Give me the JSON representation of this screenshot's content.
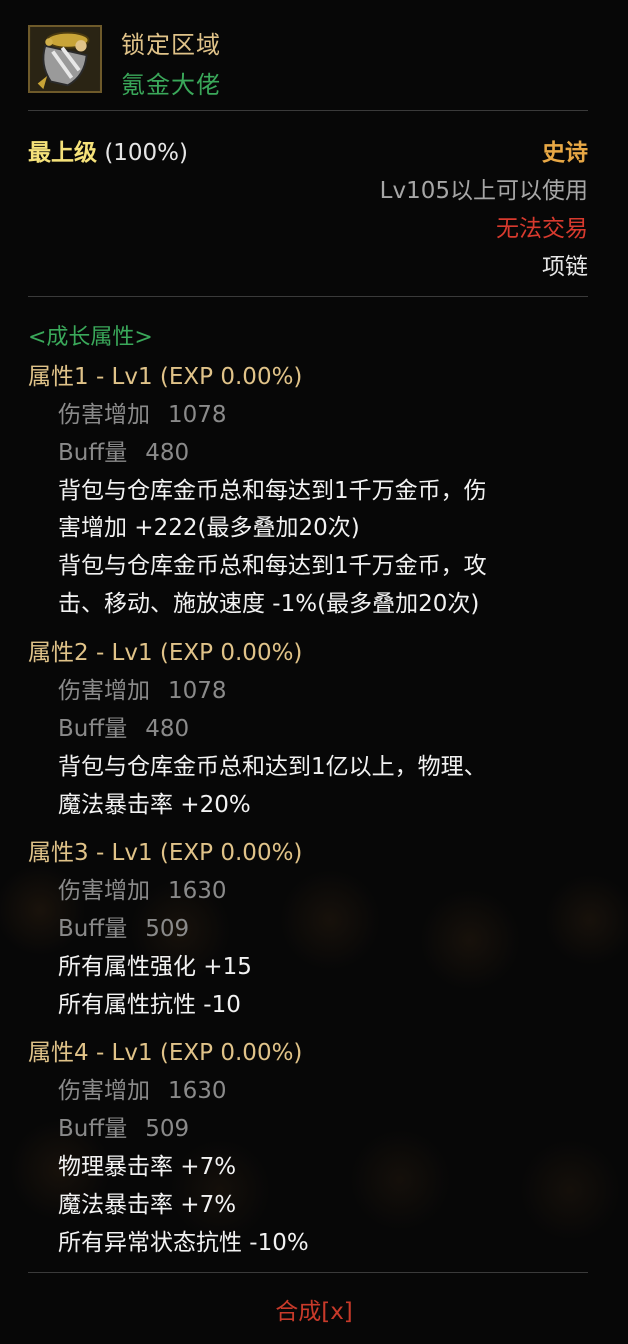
{
  "item": {
    "name": "锁定区域",
    "subtitle": "氪金大佬",
    "icon": "necklace-item-icon",
    "grade_label": "最上级",
    "grade_percent": "(100%)",
    "rarity": "史诗",
    "level_requirement": "Lv105以上可以使用",
    "trade_status": "无法交易",
    "slot": "项链"
  },
  "growth": {
    "header": "<成长属性>",
    "attributes": [
      {
        "title": "属性1 - Lv1 (EXP 0.00%)",
        "stats": [
          {
            "label": "伤害增加",
            "value": "1078"
          },
          {
            "label": "Buff量",
            "value": "480"
          }
        ],
        "effects": [
          "背包与仓库金币总和每达到1千万金币，伤",
          "害增加 +222(最多叠加20次)",
          "背包与仓库金币总和每达到1千万金币，攻",
          "击、移动、施放速度 -1%(最多叠加20次)"
        ]
      },
      {
        "title": "属性2 - Lv1 (EXP 0.00%)",
        "stats": [
          {
            "label": "伤害增加",
            "value": "1078"
          },
          {
            "label": "Buff量",
            "value": "480"
          }
        ],
        "effects": [
          "背包与仓库金币总和达到1亿以上，物理、",
          "魔法暴击率 +20%"
        ]
      },
      {
        "title": "属性3 - Lv1 (EXP 0.00%)",
        "stats": [
          {
            "label": "伤害增加",
            "value": "1630"
          },
          {
            "label": "Buff量",
            "value": "509"
          }
        ],
        "effects": [
          "所有属性强化 +15",
          "所有属性抗性 -10"
        ]
      },
      {
        "title": "属性4 - Lv1 (EXP 0.00%)",
        "stats": [
          {
            "label": "伤害增加",
            "value": "1630"
          },
          {
            "label": "Buff量",
            "value": "509"
          }
        ],
        "effects": [
          "物理暴击率 +7%",
          "魔法暴击率 +7%",
          "所有异常状态抗性 -10%"
        ]
      }
    ]
  },
  "footer": {
    "label": "合成[x]"
  },
  "colors": {
    "title_gold": "#e0c389",
    "subtitle_green": "#3aa85a",
    "grade_yellow": "#f5e27a",
    "rarity_orange": "#e8a845",
    "untradable_red": "#d83a2e",
    "stat_gray": "#8a8a8a"
  }
}
